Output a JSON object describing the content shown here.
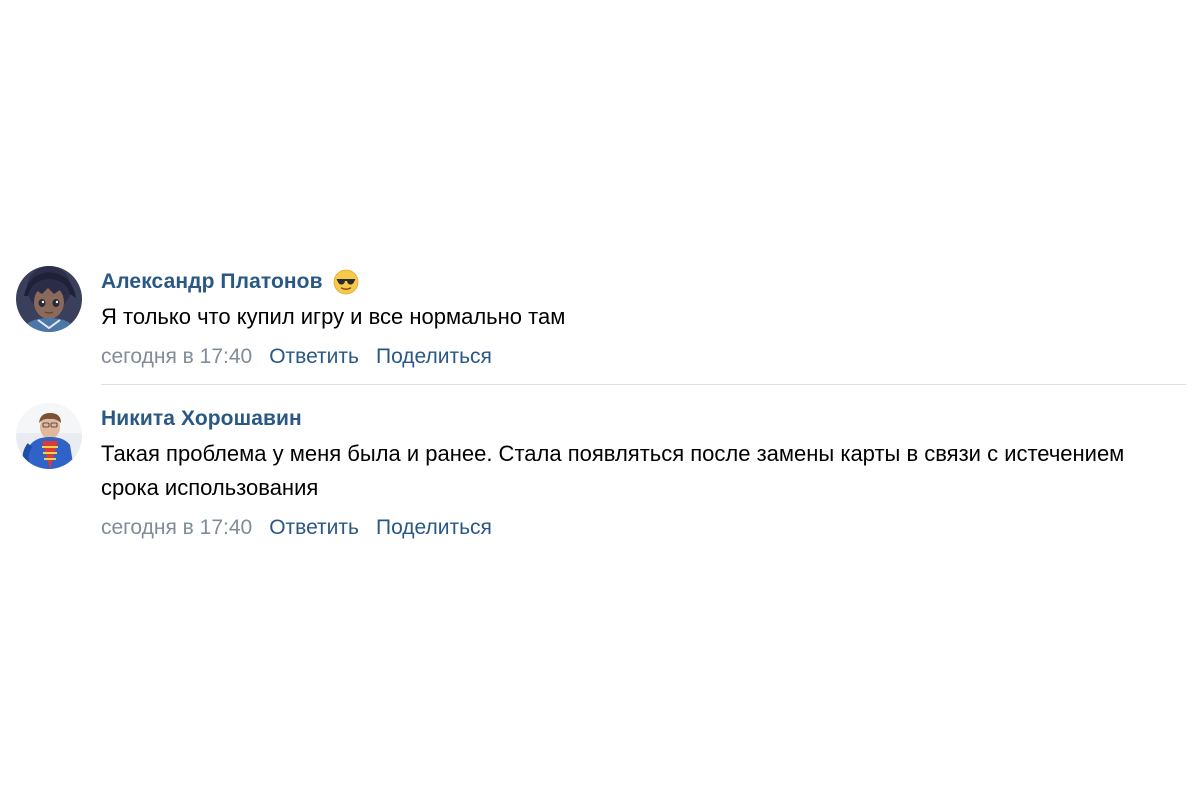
{
  "comments": [
    {
      "author": "Александр Платонов",
      "has_emoji": true,
      "emoji_icon": "sunglasses-face-icon",
      "text": "Я только что купил игру и все нормально там",
      "date": "сегодня в 17:40",
      "reply_label": "Ответить",
      "share_label": "Поделиться"
    },
    {
      "author": "Никита Хорошавин",
      "has_emoji": false,
      "text": "Такая проблема у меня была и ранее. Стала появляться после замены карты в связи с истечением срока использования",
      "date": "сегодня в 17:40",
      "reply_label": "Ответить",
      "share_label": "Поделиться"
    }
  ],
  "colors": {
    "link": "#2a5885",
    "meta": "#818c99",
    "divider": "#dce1e6",
    "text": "#000000"
  }
}
